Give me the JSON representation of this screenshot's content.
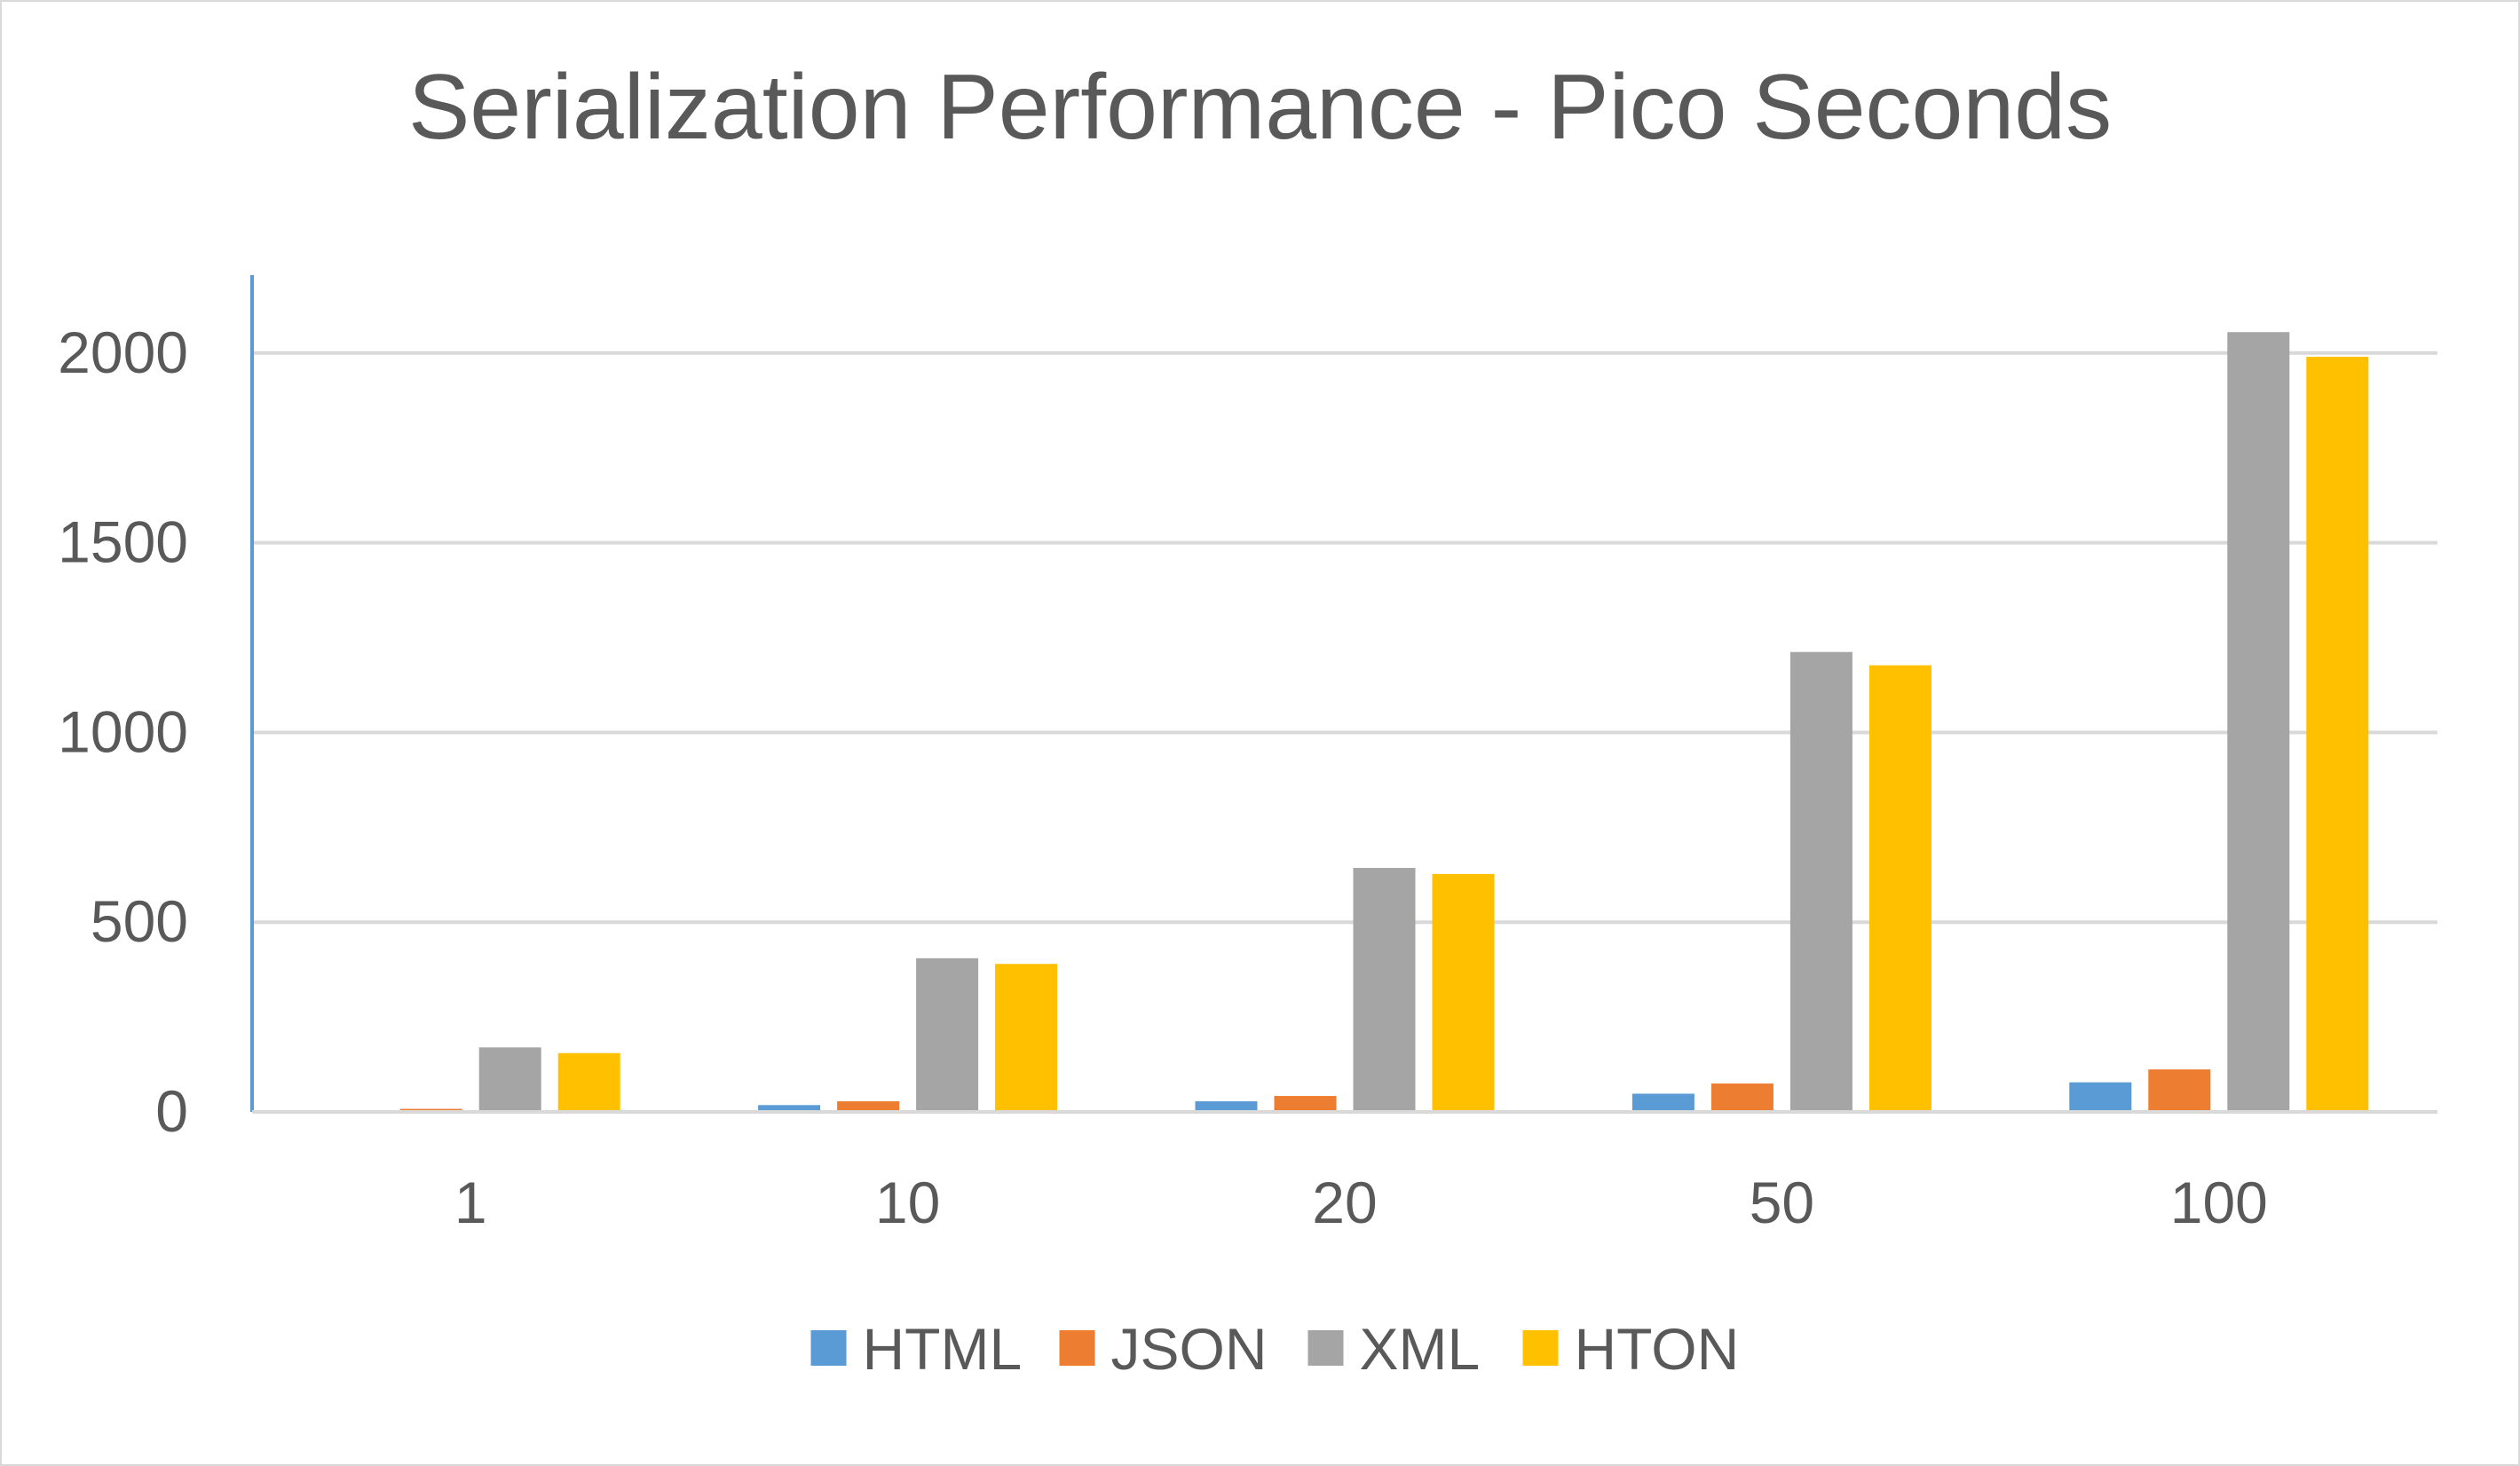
{
  "chart_data": {
    "type": "bar",
    "title": "Serialization Performance - Pico Seconds",
    "xlabel": "",
    "ylabel": "",
    "categories": [
      "1",
      "10",
      "20",
      "50",
      "100"
    ],
    "series": [
      {
        "name": "HTML",
        "color": "#5b9bd5",
        "values": [
          4,
          18,
          28,
          48,
          78
        ]
      },
      {
        "name": "JSON",
        "color": "#ed7d31",
        "values": [
          8,
          28,
          42,
          75,
          112
        ]
      },
      {
        "name": "XML",
        "color": "#a5a5a5",
        "values": [
          170,
          405,
          643,
          1212,
          2055
        ]
      },
      {
        "name": "HTON",
        "color": "#ffc000",
        "values": [
          155,
          390,
          627,
          1177,
          1990
        ]
      }
    ],
    "ylim": [
      0,
      2000
    ],
    "yticks": [
      0,
      500,
      1000,
      1500,
      2000
    ],
    "grid": true,
    "legend": "bottom-center"
  }
}
